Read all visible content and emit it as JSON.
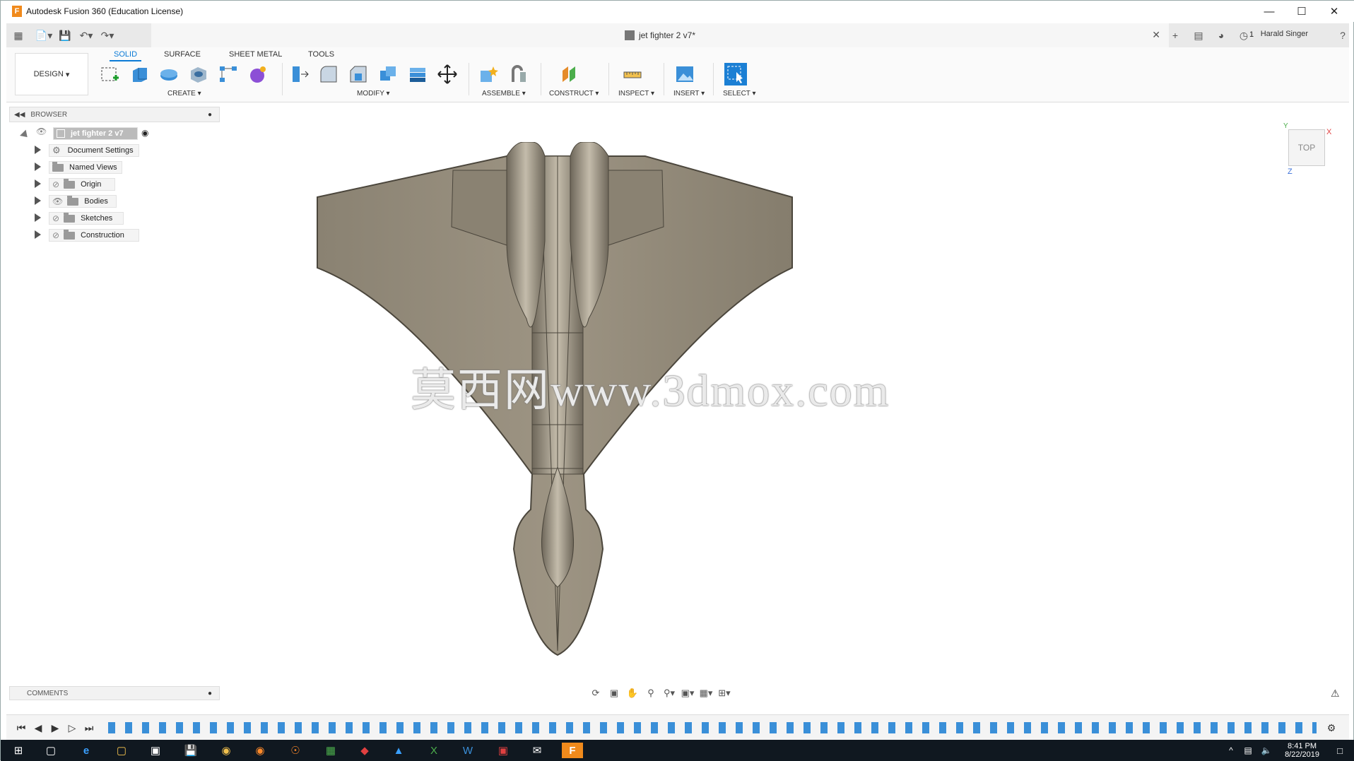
{
  "window": {
    "title": "Autodesk Fusion 360 (Education License)"
  },
  "toolbar": {
    "document_title": "jet fighter 2 v7*",
    "user_name": "Harald Singer",
    "notifications": "1"
  },
  "ribbon": {
    "workspace": "DESIGN",
    "tabs": [
      "SOLID",
      "SURFACE",
      "SHEET METAL",
      "TOOLS"
    ],
    "groups": [
      "CREATE",
      "MODIFY",
      "ASSEMBLE",
      "CONSTRUCT",
      "INSPECT",
      "INSERT",
      "SELECT"
    ]
  },
  "browser": {
    "title": "BROWSER",
    "root": "jet fighter 2 v7",
    "items": [
      "Document Settings",
      "Named Views",
      "Origin",
      "Bodies",
      "Sketches",
      "Construction"
    ]
  },
  "comments": {
    "title": "COMMENTS"
  },
  "viewcube": {
    "face": "TOP",
    "axis_x": "X",
    "axis_y": "Y",
    "axis_z": "Z"
  },
  "watermark": {
    "text": "莫西网www.3dmox.com"
  },
  "taskbar": {
    "time": "8:41 PM",
    "date": "8/22/2019"
  },
  "colors": {
    "accent": "#0a7ad6",
    "model": "#8f8676",
    "model_edge": "#4b463c",
    "brand": "#f08a1c"
  }
}
